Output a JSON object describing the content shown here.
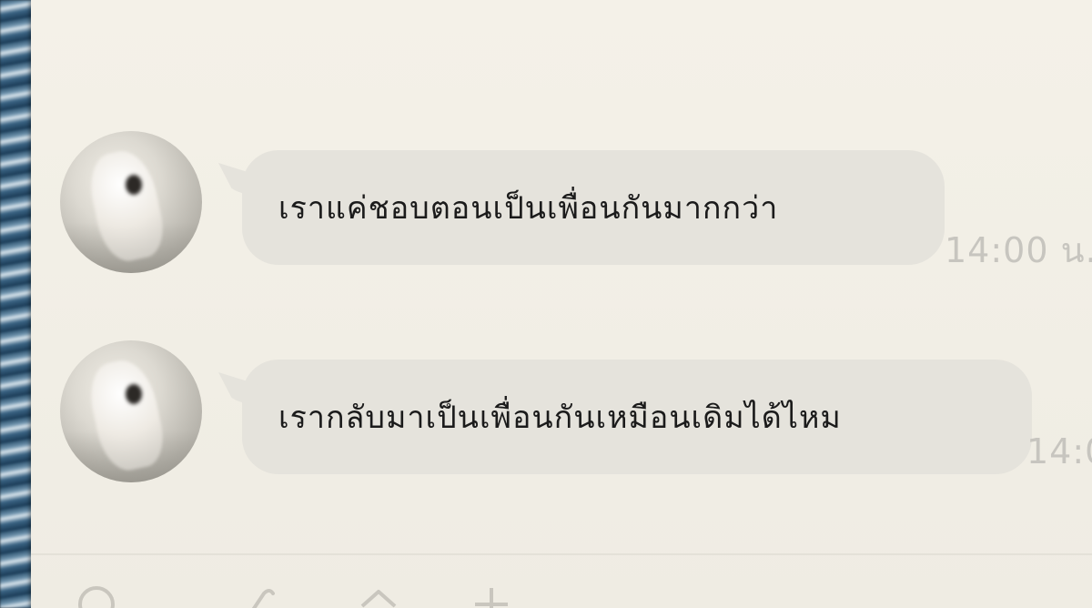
{
  "messages": [
    {
      "text": "เราแค่ชอบตอนเป็นเพื่อนกันมากกว่า",
      "time": "14:00 น."
    },
    {
      "text": "เรากลับมาเป็นเพื่อนกันเหมือนเดิมได้ไหม",
      "time": "14:0"
    }
  ],
  "toolbar": {
    "icons": [
      "emoji-icon",
      "attach-icon",
      "home-icon",
      "more-icon"
    ]
  }
}
